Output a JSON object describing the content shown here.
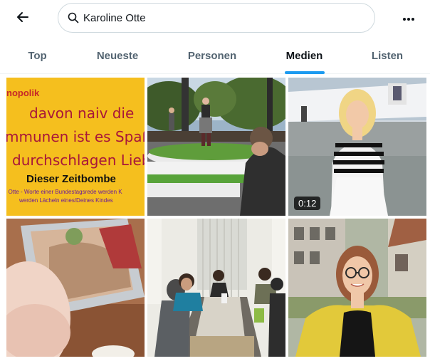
{
  "search": {
    "value": "Karoline Otte"
  },
  "tabs": [
    {
      "label": "Top",
      "active": false
    },
    {
      "label": "Neueste",
      "active": false
    },
    {
      "label": "Personen",
      "active": false
    },
    {
      "label": "Medien",
      "active": true
    },
    {
      "label": "Listen",
      "active": false
    }
  ],
  "colors": {
    "accent": "#1d9bf0",
    "text": "#0f1419",
    "muted": "#536471"
  },
  "media": [
    {
      "kind": "image",
      "text_lines": [
        "nopolik",
        "davon naiv die",
        "mmunen ist es Spaß w",
        "durchschlagen Liebe",
        "Dieser Zeitbombe",
        "e Otte - Worte einer Bundestagsrede werden K",
        "werden Lächeln eines/Deines Kindes"
      ]
    },
    {
      "kind": "image"
    },
    {
      "kind": "video",
      "duration": "0:12"
    },
    {
      "kind": "image"
    },
    {
      "kind": "image"
    },
    {
      "kind": "image"
    }
  ]
}
